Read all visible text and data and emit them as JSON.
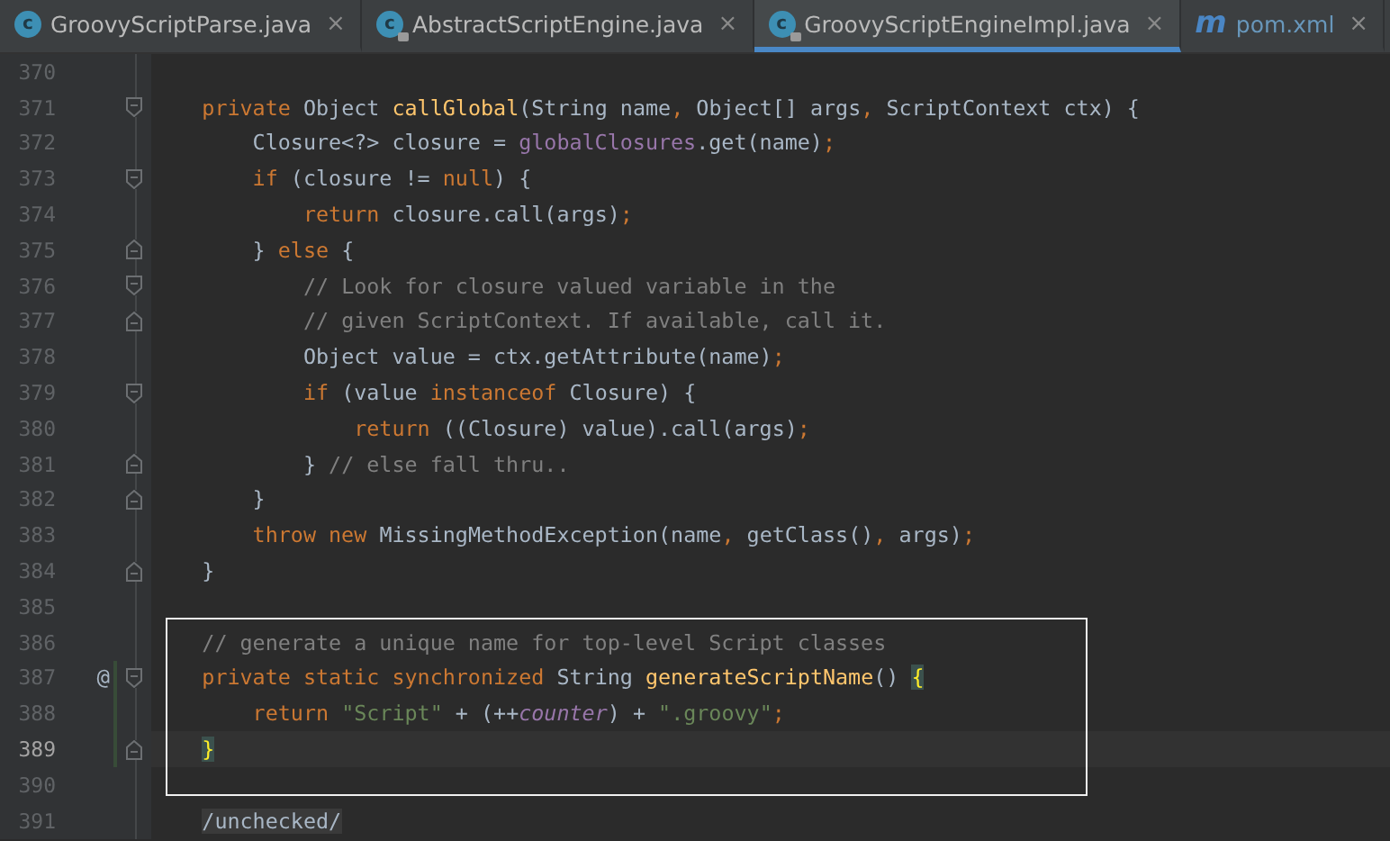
{
  "tabs": [
    {
      "label": "GroovyScriptParse.java",
      "kind": "class",
      "icon_glyph": "c",
      "locked": false,
      "selected": false,
      "close": "×"
    },
    {
      "label": "AbstractScriptEngine.java",
      "kind": "class",
      "icon_glyph": "c",
      "locked": true,
      "selected": false,
      "close": "×"
    },
    {
      "label": "GroovyScriptEngineImpl.java",
      "kind": "class",
      "icon_glyph": "c",
      "locked": true,
      "selected": true,
      "close": "×"
    },
    {
      "label": "pom.xml",
      "kind": "maven",
      "icon_glyph": "m",
      "locked": false,
      "selected": false,
      "close": "×"
    }
  ],
  "lines": [
    {
      "number": "370",
      "current": false,
      "framed": false,
      "changed": false
    },
    {
      "number": "371",
      "fold": {
        "kind": "start"
      },
      "current": false,
      "framed": false,
      "changed": false,
      "code": [
        {
          "kind": "keyword",
          "text": "    private"
        },
        {
          "kind": "plain",
          "text": " Object "
        },
        {
          "kind": "method",
          "text": "callGlobal"
        },
        {
          "kind": "plain",
          "text": "(String name"
        },
        {
          "kind": "keyword",
          "text": ","
        },
        {
          "kind": "plain",
          "text": " Object[] args"
        },
        {
          "kind": "keyword",
          "text": ","
        },
        {
          "kind": "plain",
          "text": " ScriptContext ctx) {"
        }
      ]
    },
    {
      "number": "372",
      "current": false,
      "framed": false,
      "changed": false,
      "code": [
        {
          "kind": "plain",
          "text": "        Closure<?> closure = "
        },
        {
          "kind": "field",
          "text": "globalClosures"
        },
        {
          "kind": "plain",
          "text": ".get(name)"
        },
        {
          "kind": "keyword",
          "text": ";"
        }
      ]
    },
    {
      "number": "373",
      "fold": {
        "kind": "start"
      },
      "current": false,
      "framed": false,
      "changed": false,
      "code": [
        {
          "kind": "keyword",
          "text": "        if"
        },
        {
          "kind": "plain",
          "text": " (closure != "
        },
        {
          "kind": "keyword",
          "text": "null"
        },
        {
          "kind": "plain",
          "text": ") {"
        }
      ]
    },
    {
      "number": "374",
      "current": false,
      "framed": false,
      "changed": false,
      "code": [
        {
          "kind": "keyword",
          "text": "            return"
        },
        {
          "kind": "plain",
          "text": " closure.call(args)"
        },
        {
          "kind": "keyword",
          "text": ";"
        }
      ]
    },
    {
      "number": "375",
      "fold": {
        "kind": "end"
      },
      "current": false,
      "framed": false,
      "changed": false,
      "code": [
        {
          "kind": "plain",
          "text": "        } "
        },
        {
          "kind": "keyword",
          "text": "else"
        },
        {
          "kind": "plain",
          "text": " {"
        }
      ]
    },
    {
      "number": "376",
      "fold": {
        "kind": "start"
      },
      "current": false,
      "framed": false,
      "changed": false,
      "code": [
        {
          "kind": "comment",
          "text": "            // Look for closure valued variable in the"
        }
      ]
    },
    {
      "number": "377",
      "fold": {
        "kind": "end"
      },
      "current": false,
      "framed": false,
      "changed": false,
      "code": [
        {
          "kind": "comment",
          "text": "            // given ScriptContext. If available, call it."
        }
      ]
    },
    {
      "number": "378",
      "current": false,
      "framed": false,
      "changed": false,
      "code": [
        {
          "kind": "plain",
          "text": "            Object value = ctx.getAttribute(name)"
        },
        {
          "kind": "keyword",
          "text": ";"
        }
      ]
    },
    {
      "number": "379",
      "fold": {
        "kind": "start"
      },
      "current": false,
      "framed": false,
      "changed": false,
      "code": [
        {
          "kind": "keyword",
          "text": "            if"
        },
        {
          "kind": "plain",
          "text": " (value "
        },
        {
          "kind": "keyword",
          "text": "instanceof"
        },
        {
          "kind": "plain",
          "text": " Closure) {"
        }
      ]
    },
    {
      "number": "380",
      "current": false,
      "framed": false,
      "changed": false,
      "code": [
        {
          "kind": "keyword",
          "text": "                return"
        },
        {
          "kind": "plain",
          "text": " ((Closure) value).call(args)"
        },
        {
          "kind": "keyword",
          "text": ";"
        }
      ]
    },
    {
      "number": "381",
      "fold": {
        "kind": "end"
      },
      "current": false,
      "framed": false,
      "changed": false,
      "code": [
        {
          "kind": "plain",
          "text": "            } "
        },
        {
          "kind": "comment",
          "text": "// else fall thru.."
        }
      ]
    },
    {
      "number": "382",
      "fold": {
        "kind": "end"
      },
      "current": false,
      "framed": false,
      "changed": false,
      "code": [
        {
          "kind": "plain",
          "text": "        }"
        }
      ]
    },
    {
      "number": "383",
      "current": false,
      "framed": false,
      "changed": false,
      "code": [
        {
          "kind": "keyword",
          "text": "        throw new"
        },
        {
          "kind": "plain",
          "text": " MissingMethodException(name"
        },
        {
          "kind": "keyword",
          "text": ","
        },
        {
          "kind": "plain",
          "text": " getClass()"
        },
        {
          "kind": "keyword",
          "text": ","
        },
        {
          "kind": "plain",
          "text": " args)"
        },
        {
          "kind": "keyword",
          "text": ";"
        }
      ]
    },
    {
      "number": "384",
      "fold": {
        "kind": "end"
      },
      "current": false,
      "framed": false,
      "changed": false,
      "code": [
        {
          "kind": "plain",
          "text": "    }"
        }
      ]
    },
    {
      "number": "385",
      "current": false,
      "framed": false,
      "changed": false
    },
    {
      "number": "386",
      "current": false,
      "framed": true,
      "changed": false,
      "code": [
        {
          "kind": "comment",
          "text": "    // generate a unique name for top-level Script classes"
        }
      ]
    },
    {
      "number": "387",
      "fold": {
        "kind": "start"
      },
      "marker": "@",
      "current": false,
      "framed": true,
      "changed": true,
      "code": [
        {
          "kind": "keyword",
          "text": "    private static synchronized"
        },
        {
          "kind": "plain",
          "text": " String "
        },
        {
          "kind": "method",
          "text": "generateScriptName"
        },
        {
          "kind": "plain",
          "text": "() "
        },
        {
          "kind": "brace_match",
          "text": "{"
        }
      ]
    },
    {
      "number": "388",
      "current": false,
      "framed": true,
      "changed": true,
      "code": [
        {
          "kind": "keyword",
          "text": "        return"
        },
        {
          "kind": "string",
          "text": " \"Script\""
        },
        {
          "kind": "plain",
          "text": " + (++"
        },
        {
          "kind": "static_field",
          "text": "counter"
        },
        {
          "kind": "plain",
          "text": ") + "
        },
        {
          "kind": "string",
          "text": "\".groovy\""
        },
        {
          "kind": "keyword",
          "text": ";"
        }
      ]
    },
    {
      "number": "389",
      "fold": {
        "kind": "end"
      },
      "current": true,
      "framed": true,
      "changed": true,
      "code": [
        {
          "kind": "brace_match",
          "text": "    }"
        }
      ]
    },
    {
      "number": "390",
      "current": false,
      "framed": true,
      "changed": false
    },
    {
      "number": "391",
      "current": false,
      "framed": false,
      "changed": false,
      "code": [
        {
          "kind": "shaded",
          "text": "    /unchecked/"
        }
      ]
    }
  ]
}
